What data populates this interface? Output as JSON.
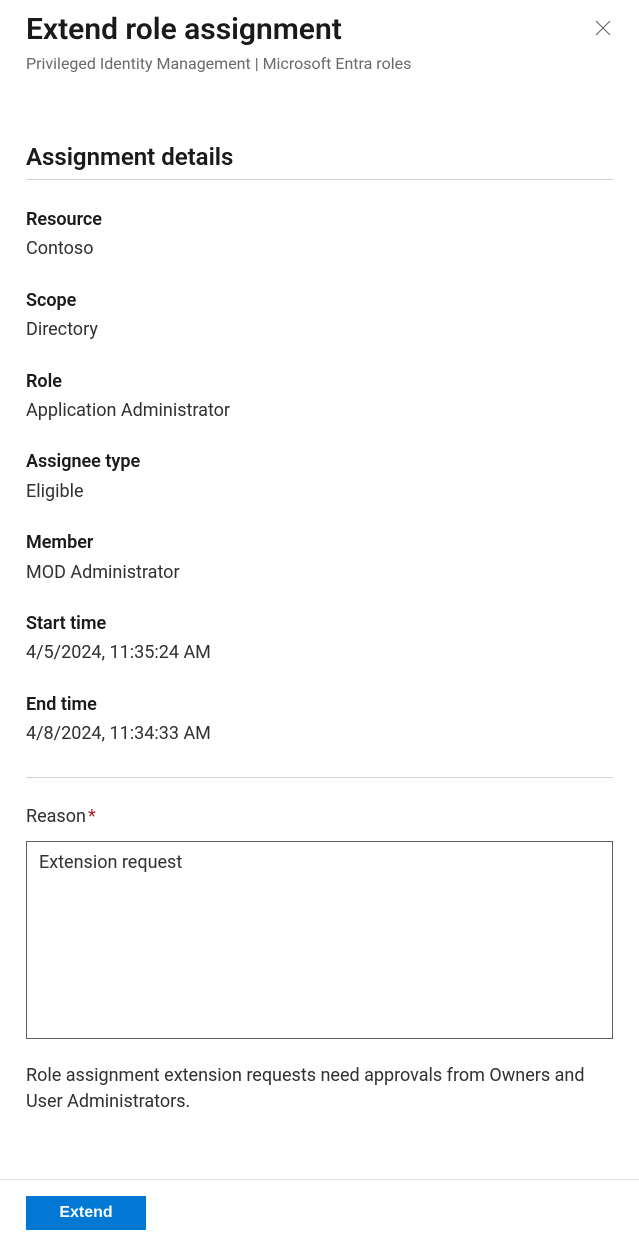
{
  "header": {
    "title": "Extend role assignment",
    "breadcrumb": "Privileged Identity Management | Microsoft Entra roles"
  },
  "section": {
    "title": "Assignment details"
  },
  "fields": {
    "resource": {
      "label": "Resource",
      "value": "Contoso"
    },
    "scope": {
      "label": "Scope",
      "value": "Directory"
    },
    "role": {
      "label": "Role",
      "value": "Application Administrator"
    },
    "assignee_type": {
      "label": "Assignee type",
      "value": "Eligible"
    },
    "member": {
      "label": "Member",
      "value": "MOD Administrator"
    },
    "start_time": {
      "label": "Start time",
      "value": "4/5/2024, 11:35:24 AM"
    },
    "end_time": {
      "label": "End time",
      "value": "4/8/2024, 11:34:33 AM"
    }
  },
  "reason": {
    "label": "Reason",
    "value": "Extension request"
  },
  "note": "Role assignment extension requests need approvals from Owners and User Administrators.",
  "footer": {
    "extend_label": "Extend"
  }
}
